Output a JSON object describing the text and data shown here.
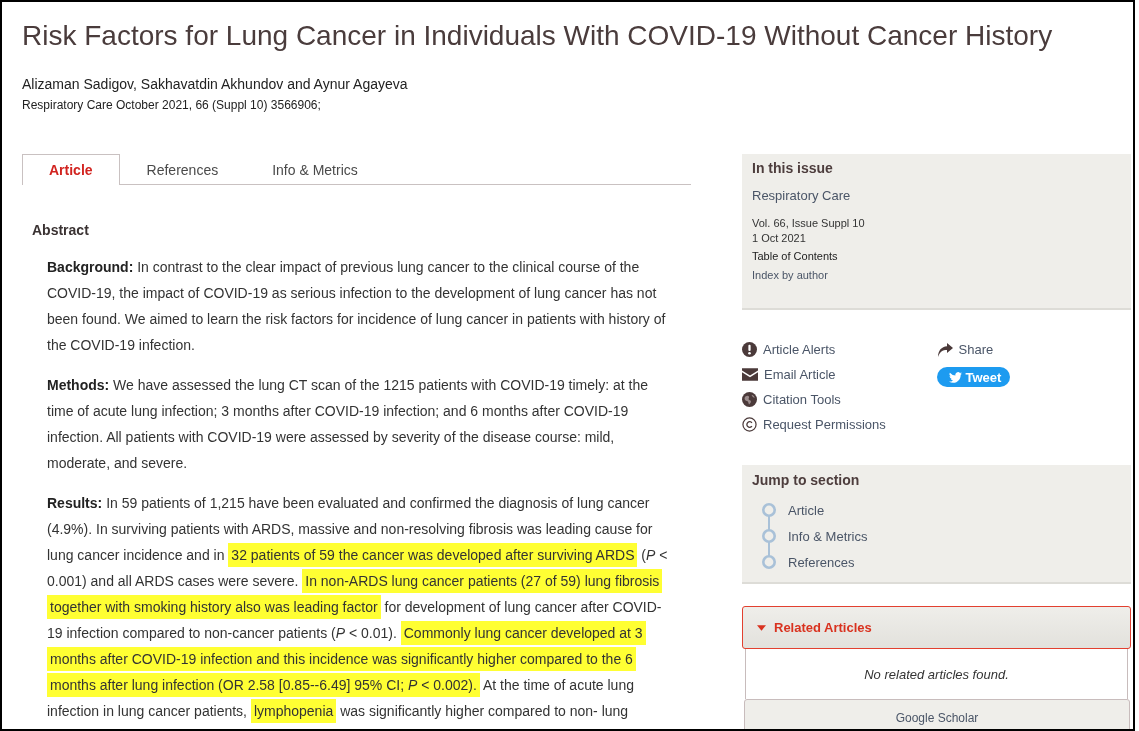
{
  "article": {
    "title": "Risk Factors for Lung Cancer in Individuals With COVID-19 Without Cancer History",
    "authors": "Alizaman Sadigov, Sakhavatdin Akhundov and Aynur Agayeva",
    "citation": "Respiratory Care October 2021, 66 (Suppl 10) 3566906;"
  },
  "tabs": [
    {
      "label": "Article",
      "selected": true
    },
    {
      "label": "References",
      "selected": false
    },
    {
      "label": "Info & Metrics",
      "selected": false
    }
  ],
  "abstract": {
    "heading": "Abstract",
    "sections": [
      {
        "label": "Background:",
        "segments": [
          {
            "text": "In contrast to the clear impact of previous lung cancer to the clinical course of the COVID-19, the impact of COVID-19 as serious infection to the development of lung cancer has not been found. We aimed to learn the risk factors for incidence of lung cancer in patients with history of the COVID-19 infection.",
            "highlighted": false
          }
        ]
      },
      {
        "label": "Methods:",
        "segments": [
          {
            "text": "We have assessed the lung CT scan of the 1215 patients with COVID-19 timely: at the time of acute lung infection; 3 months after COVID-19 infection; and 6 months after COVID-19 infection. All patients with COVID-19 were assessed by severity of the disease course: mild, moderate, and severe.",
            "highlighted": false
          }
        ]
      },
      {
        "label": "Results:",
        "segments": [
          {
            "text": "In 59 patients of 1,215 have been evaluated and confirmed the diagnosis of lung cancer (4.9%). In surviving patients with ARDS, massive and non-resolving fibrosis was leading cause for lung cancer incidence and in ",
            "highlighted": false
          },
          {
            "text": "32 patients of 59 the cancer was developed after surviving ARDS",
            "highlighted": true
          },
          {
            "text": " (*P* < 0.001) and all ARDS cases were severe. ",
            "highlighted": false
          },
          {
            "text": "In non-ARDS lung cancer patients (27 of 59) lung fibrosis together with smoking history also was leading factor",
            "highlighted": true
          },
          {
            "text": " for development of lung cancer after COVID-19 infection compared to non-cancer patients (*P* < 0.01). ",
            "highlighted": false
          },
          {
            "text": "Commonly lung cancer developed at 3 months after COVID-19 infection and this incidence was significantly higher compared to the 6 months after lung infection (OR 2.58 [0.85--6.49] 95% CI; *P* < 0.002).",
            "highlighted": true
          },
          {
            "text": " At the time of acute lung infection in lung cancer patients, ",
            "highlighted": false
          },
          {
            "text": "lymphopenia",
            "highlighted": true
          },
          {
            "text": " was significantly higher compared to non- lung",
            "highlighted": false
          }
        ]
      }
    ]
  },
  "sidebar": {
    "issue": {
      "heading": "In this issue",
      "journal": "Respiratory Care",
      "volume": "Vol. 66, Issue Suppl 10",
      "date": "1 Oct 2021",
      "toc_link": "Table of Contents",
      "index_link": "Index by author"
    },
    "actions": [
      {
        "label": "Article Alerts"
      },
      {
        "label": "Email Article"
      },
      {
        "label": "Citation Tools"
      },
      {
        "label": "Request Permissions"
      }
    ],
    "share": {
      "label": "Share",
      "tweet": "Tweet"
    },
    "jump_to_section": {
      "heading": "Jump to section",
      "items": [
        "Article",
        "Info & Metrics",
        "References"
      ]
    },
    "related_articles": {
      "heading": "Related Articles",
      "expanded": true,
      "message": "No related articles found.",
      "google_scholar": "Google Scholar"
    }
  }
}
